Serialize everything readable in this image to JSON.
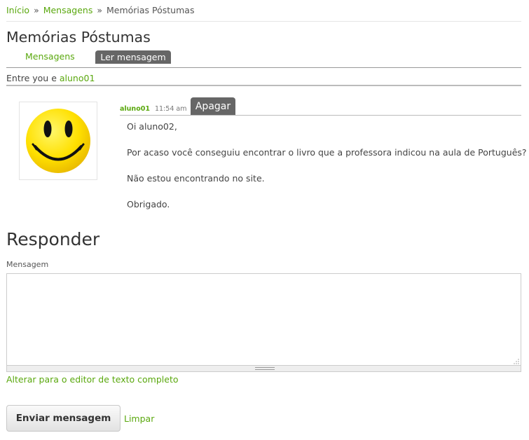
{
  "breadcrumb": {
    "items": [
      "Início",
      "Mensagens",
      "Memórias Póstumas"
    ],
    "separator": "»"
  },
  "page": {
    "title": "Memórias Póstumas"
  },
  "tabs": [
    {
      "label": "Mensagens",
      "active": false
    },
    {
      "label": "Ler mensagem",
      "active": true
    }
  ],
  "conversation": {
    "prefix": "Entre you e",
    "user": "aluno01"
  },
  "message": {
    "author": "aluno01",
    "time": "11:54 am",
    "delete_label": "Apagar",
    "avatar_icon": "smiley-face-icon",
    "paragraphs": [
      "Oi aluno02,",
      "Por acaso você conseguiu encontrar o livro que a professora indicou na aula de Português?",
      "Não estou encontrando no site.",
      "Obrigado."
    ]
  },
  "reply": {
    "title": "Responder",
    "field_label": "Mensagem",
    "textarea_value": "",
    "switch_editor_label": "Alterar para o editor de texto completo",
    "send_label": "Enviar mensagem",
    "clear_label": "Limpar"
  },
  "colors": {
    "accent": "#5aa80e",
    "tab_active": "#666666"
  }
}
